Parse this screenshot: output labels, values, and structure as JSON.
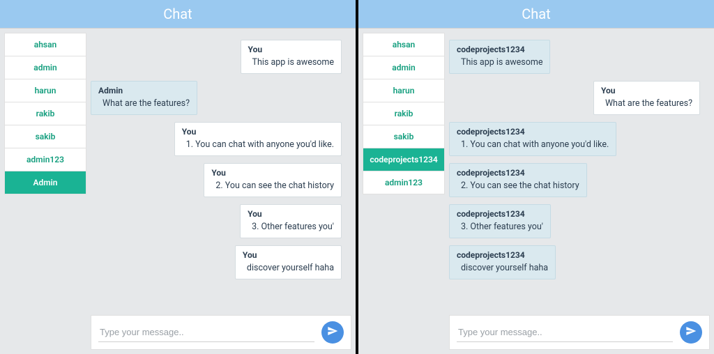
{
  "left": {
    "title": "Chat",
    "users": [
      {
        "name": "ahsan",
        "active": false
      },
      {
        "name": "admin",
        "active": false
      },
      {
        "name": "harun",
        "active": false
      },
      {
        "name": "rakib",
        "active": false
      },
      {
        "name": "sakib",
        "active": false
      },
      {
        "name": "admin123",
        "active": false
      },
      {
        "name": "Admin",
        "active": true
      }
    ],
    "messages": [
      {
        "sender": "You",
        "text": "This app is awesome",
        "side": "right"
      },
      {
        "sender": "Admin",
        "text": "What are the features?",
        "side": "left"
      },
      {
        "sender": "You",
        "text": "1. You can chat with anyone you'd like.",
        "side": "right"
      },
      {
        "sender": "You",
        "text": "2. You can see the chat history",
        "side": "right"
      },
      {
        "sender": "You",
        "text": "3. Other features you'",
        "side": "right"
      },
      {
        "sender": "You",
        "text": "discover yourself haha",
        "side": "right"
      }
    ],
    "composer_placeholder": "Type your message.."
  },
  "right": {
    "title": "Chat",
    "users": [
      {
        "name": "ahsan",
        "active": false
      },
      {
        "name": "admin",
        "active": false
      },
      {
        "name": "harun",
        "active": false
      },
      {
        "name": "rakib",
        "active": false
      },
      {
        "name": "sakib",
        "active": false
      },
      {
        "name": "codeprojects1234",
        "active": true
      },
      {
        "name": "admin123",
        "active": false
      }
    ],
    "messages": [
      {
        "sender": "codeprojects1234",
        "text": "This app is awesome",
        "side": "left"
      },
      {
        "sender": "You",
        "text": "What are the features?",
        "side": "right"
      },
      {
        "sender": "codeprojects1234",
        "text": "1. You can chat with anyone you'd like.",
        "side": "left"
      },
      {
        "sender": "codeprojects1234",
        "text": "2. You can see the chat history",
        "side": "left"
      },
      {
        "sender": "codeprojects1234",
        "text": "3. Other features you'",
        "side": "left"
      },
      {
        "sender": "codeprojects1234",
        "text": "discover yourself haha",
        "side": "left"
      }
    ],
    "composer_placeholder": "Type your message.."
  }
}
